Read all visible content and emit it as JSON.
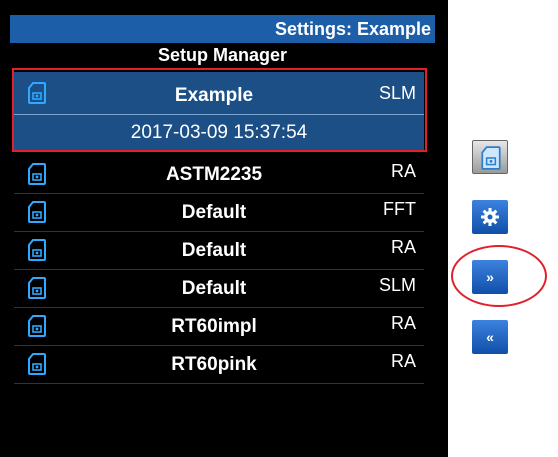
{
  "header": {
    "title": "Settings: Example",
    "subtitle": "Setup Manager"
  },
  "selected": {
    "name": "Example",
    "type": "SLM",
    "timestamp": "2017-03-09 15:37:54",
    "icon": "setup-file-icon"
  },
  "rows": [
    {
      "name": "ASTM2235",
      "type": "RA",
      "icon": "setup-file-icon"
    },
    {
      "name": "Default",
      "type": "FFT",
      "icon": "setup-file-icon"
    },
    {
      "name": "Default",
      "type": "RA",
      "icon": "setup-file-icon"
    },
    {
      "name": "Default",
      "type": "SLM",
      "icon": "setup-file-icon"
    },
    {
      "name": "RT60impl",
      "type": "RA",
      "icon": "setup-file-icon"
    },
    {
      "name": "RT60pink",
      "type": "RA",
      "icon": "setup-file-icon"
    }
  ],
  "side_buttons": [
    {
      "name": "save-setup-button",
      "icon": "setup-file-icon"
    },
    {
      "name": "settings-button",
      "icon": "gear-icon"
    },
    {
      "name": "next-button",
      "icon": "fast-forward-icon"
    },
    {
      "name": "prev-button",
      "icon": "rewind-icon"
    }
  ],
  "colors": {
    "accent": "#1d5ea8",
    "selected_bg": "#1b4f86",
    "annotation": "#e0212b",
    "icon": "#2fa8ff"
  }
}
